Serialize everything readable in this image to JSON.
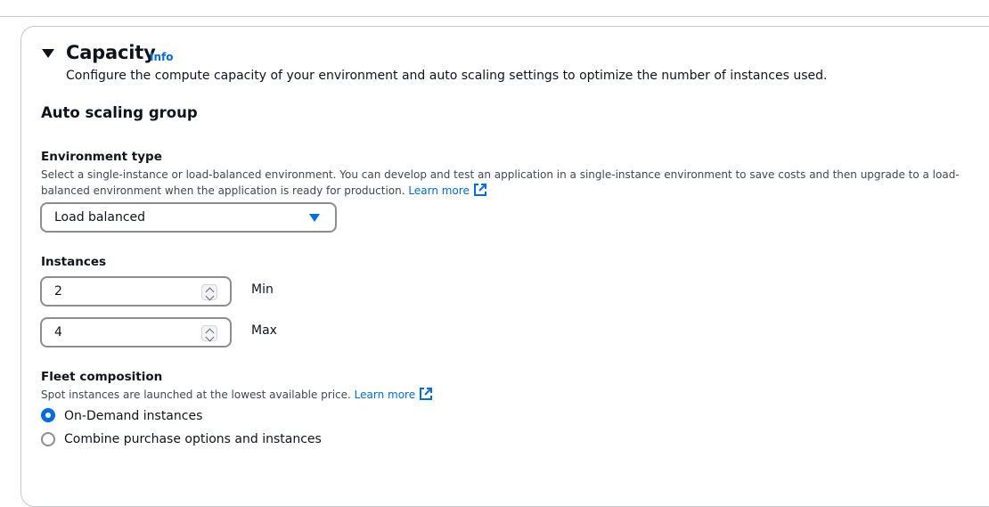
{
  "section": {
    "title": "Capacity",
    "info_label": "Info",
    "description": "Configure the compute capacity of your environment and auto scaling settings to optimize the number of instances used."
  },
  "auto_scaling": {
    "heading": "Auto scaling group",
    "environment_type": {
      "label": "Environment type",
      "hint_line1": "Select a single-instance or load-balanced environment. You can develop and test an application in a single-instance environment to save costs and then upgrade to a load-",
      "hint_line2": "balanced environment when the application is ready for production.",
      "learn_more": "Learn more",
      "selected": "Load balanced"
    },
    "instances": {
      "label": "Instances",
      "min_value": "2",
      "min_label": "Min",
      "max_value": "4",
      "max_label": "Max"
    },
    "fleet": {
      "label": "Fleet composition",
      "hint": "Spot instances are launched at the lowest available price.",
      "learn_more": "Learn more",
      "options": [
        {
          "label": "On-Demand instances",
          "selected": true
        },
        {
          "label": "Combine purchase options and instances",
          "selected": false
        }
      ]
    }
  },
  "colors": {
    "accent": "#006ce0",
    "border": "#8c8c94",
    "text": "#0f141a",
    "hint": "#424650"
  }
}
